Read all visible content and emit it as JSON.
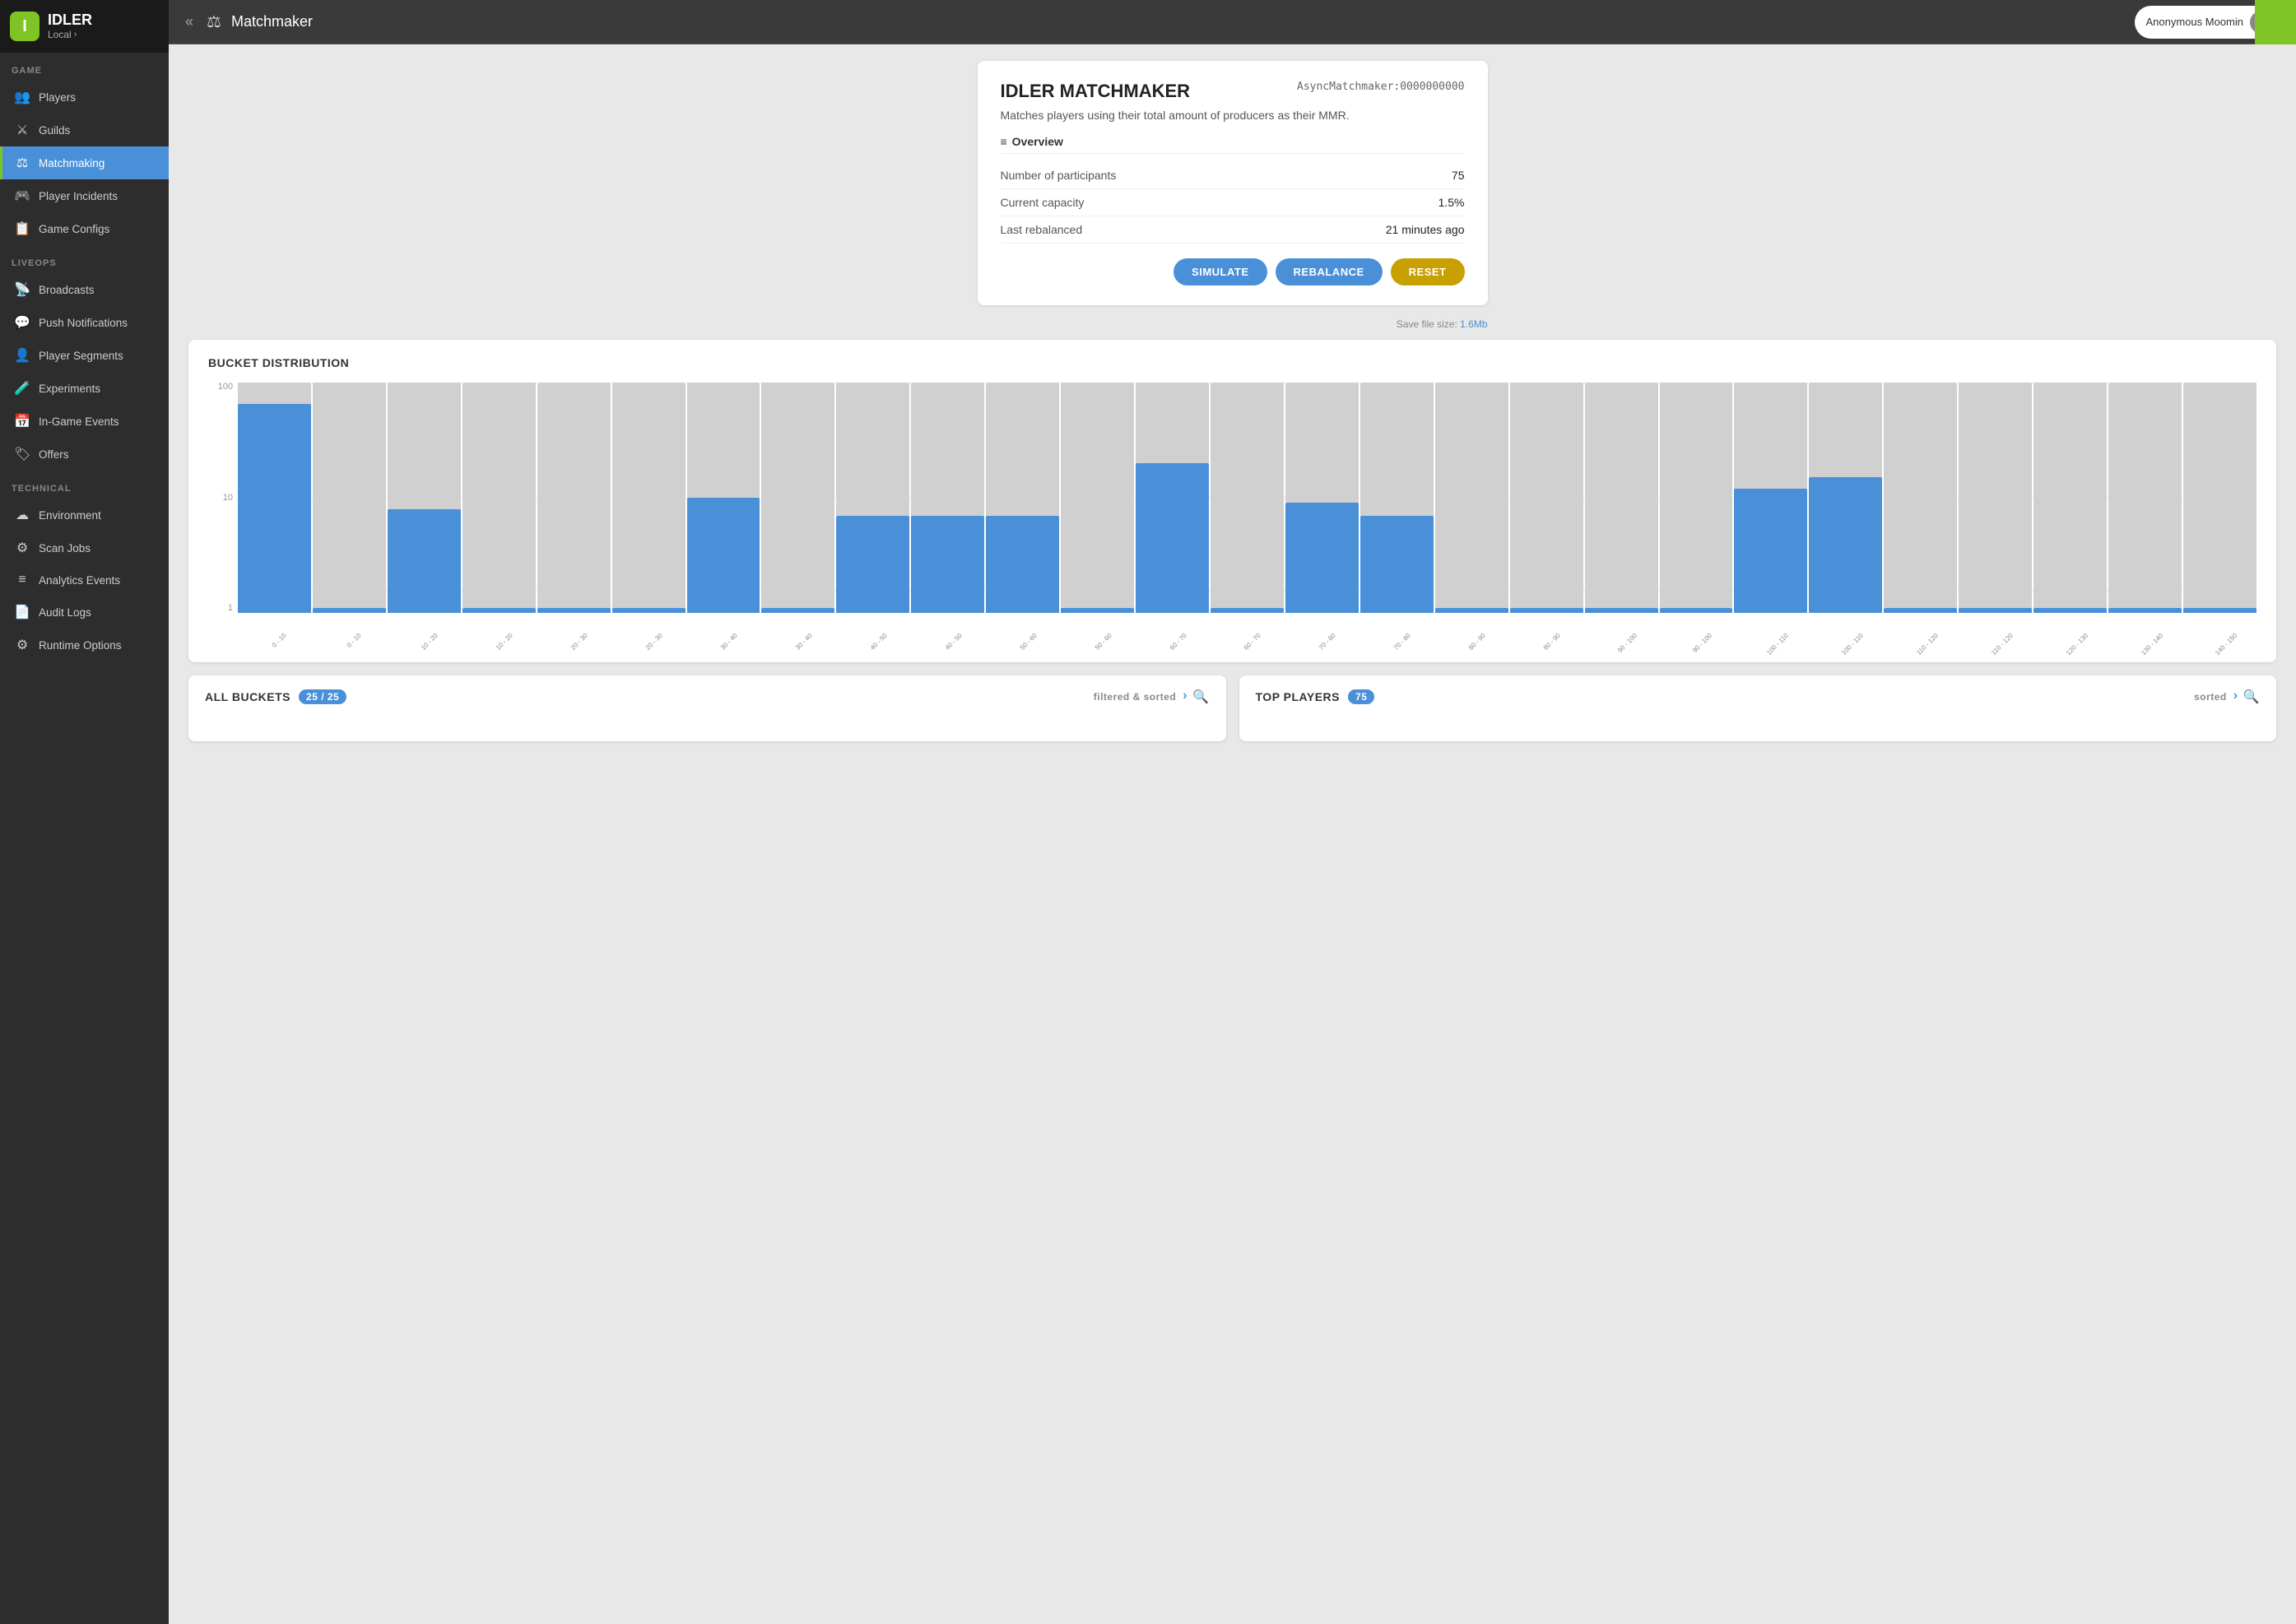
{
  "app": {
    "name": "IDLER",
    "env": "Local",
    "env_arrow": "›"
  },
  "header": {
    "collapse_icon": "«",
    "page_icon": "⚖",
    "title": "Matchmaker",
    "user": "Anonymous Moomin"
  },
  "sidebar": {
    "sections": [
      {
        "label": "GAME",
        "items": [
          {
            "id": "players",
            "icon": "👥",
            "label": "Players",
            "active": false
          },
          {
            "id": "guilds",
            "icon": "🏰",
            "label": "Guilds",
            "active": false
          },
          {
            "id": "matchmaking",
            "icon": "⚖",
            "label": "Matchmaking",
            "active": true
          },
          {
            "id": "player-incidents",
            "icon": "🎮",
            "label": "Player Incidents",
            "active": false
          },
          {
            "id": "game-configs",
            "icon": "📋",
            "label": "Game Configs",
            "active": false
          }
        ]
      },
      {
        "label": "LIVEOPS",
        "items": [
          {
            "id": "broadcasts",
            "icon": "📡",
            "label": "Broadcasts",
            "active": false
          },
          {
            "id": "push-notifications",
            "icon": "💬",
            "label": "Push Notifications",
            "active": false
          },
          {
            "id": "player-segments",
            "icon": "👤",
            "label": "Player Segments",
            "active": false
          },
          {
            "id": "experiments",
            "icon": "🧪",
            "label": "Experiments",
            "active": false
          },
          {
            "id": "in-game-events",
            "icon": "📅",
            "label": "In-Game Events",
            "active": false
          },
          {
            "id": "offers",
            "icon": "🏷",
            "label": "Offers",
            "active": false
          }
        ]
      },
      {
        "label": "TECHNICAL",
        "items": [
          {
            "id": "environment",
            "icon": "☁",
            "label": "Environment",
            "active": false
          },
          {
            "id": "scan-jobs",
            "icon": "⚙",
            "label": "Scan Jobs",
            "active": false
          },
          {
            "id": "analytics-events",
            "icon": "≡",
            "label": "Analytics Events",
            "active": false
          },
          {
            "id": "audit-logs",
            "icon": "📄",
            "label": "Audit Logs",
            "active": false
          },
          {
            "id": "runtime-options",
            "icon": "⚙",
            "label": "Runtime Options",
            "active": false
          }
        ]
      }
    ]
  },
  "infoCard": {
    "title": "IDLER MATCHMAKER",
    "id": "AsyncMatchmaker:0000000000",
    "description": "Matches players using their total amount of producers as their MMR.",
    "section_title": "Overview",
    "rows": [
      {
        "label": "Number of participants",
        "value": "75"
      },
      {
        "label": "Current capacity",
        "value": "1.5%"
      },
      {
        "label": "Last rebalanced",
        "value": "21 minutes ago"
      }
    ],
    "buttons": {
      "simulate": "SIMULATE",
      "rebalance": "REBALANCE",
      "reset": "RESET"
    },
    "save_file_prefix": "Save file size: ",
    "save_file_size": "1.6Mb"
  },
  "chart": {
    "title": "BUCKET DISTRIBUTION",
    "y_labels": [
      "100",
      "10",
      "1"
    ],
    "bars": [
      {
        "label": "0 - 10",
        "bg": 100,
        "fg": 65
      },
      {
        "label": "0 - 10",
        "bg": 100,
        "fg": 1
      },
      {
        "label": "10 - 20",
        "bg": 100,
        "fg": 8
      },
      {
        "label": "10 - 20",
        "bg": 100,
        "fg": 1
      },
      {
        "label": "20 - 30",
        "bg": 100,
        "fg": 1
      },
      {
        "label": "20 - 30",
        "bg": 100,
        "fg": 1
      },
      {
        "label": "30 - 40",
        "bg": 100,
        "fg": 10
      },
      {
        "label": "30 - 40",
        "bg": 100,
        "fg": 1
      },
      {
        "label": "40 - 50",
        "bg": 100,
        "fg": 7
      },
      {
        "label": "40 - 50",
        "bg": 100,
        "fg": 7
      },
      {
        "label": "50 - 60",
        "bg": 100,
        "fg": 7
      },
      {
        "label": "50 - 60",
        "bg": 100,
        "fg": 1
      },
      {
        "label": "60 - 70",
        "bg": 100,
        "fg": 20
      },
      {
        "label": "60 - 70",
        "bg": 100,
        "fg": 1
      },
      {
        "label": "70 - 80",
        "bg": 100,
        "fg": 9
      },
      {
        "label": "70 - 80",
        "bg": 100,
        "fg": 7
      },
      {
        "label": "80 - 90",
        "bg": 100,
        "fg": 1
      },
      {
        "label": "80 - 90",
        "bg": 100,
        "fg": 1
      },
      {
        "label": "90 - 100",
        "bg": 100,
        "fg": 1
      },
      {
        "label": "90 - 100",
        "bg": 100,
        "fg": 1
      },
      {
        "label": "100 - 110",
        "bg": 100,
        "fg": 12
      },
      {
        "label": "100 - 110",
        "bg": 100,
        "fg": 15
      },
      {
        "label": "110 - 120",
        "bg": 100,
        "fg": 1
      },
      {
        "label": "110 - 120",
        "bg": 100,
        "fg": 1
      },
      {
        "label": "120 - 130",
        "bg": 100,
        "fg": 1
      },
      {
        "label": "130 - 140",
        "bg": 100,
        "fg": 1
      },
      {
        "label": "140 - 150",
        "bg": 100,
        "fg": 1
      }
    ]
  },
  "allBuckets": {
    "title": "ALL BUCKETS",
    "badge": "25 / 25",
    "filter_label": "filtered & sorted",
    "filter_icon": "›",
    "search_icon": "🔍"
  },
  "topPlayers": {
    "title": "TOP PLAYERS",
    "badge": "75",
    "sort_label": "sorted",
    "sort_icon": "›",
    "search_icon": "🔍"
  }
}
